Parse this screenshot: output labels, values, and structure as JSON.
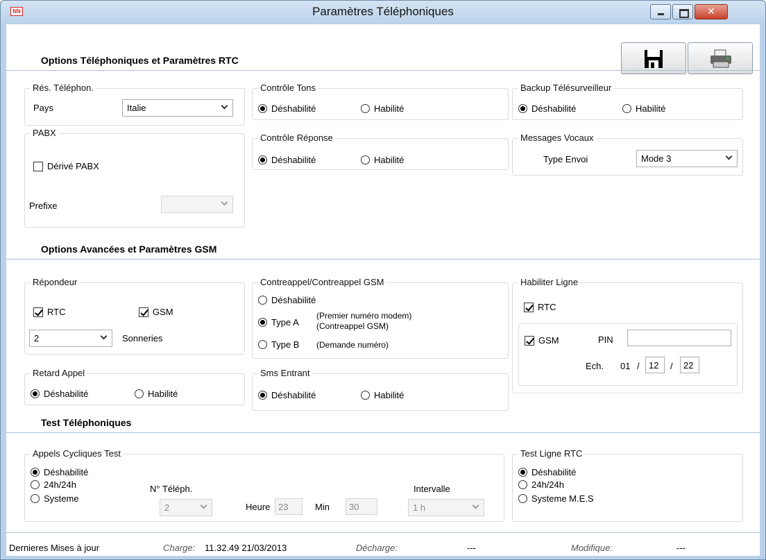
{
  "window": {
    "title": "Paramètres Téléphoniques",
    "app_icon_text": "NN"
  },
  "sections": {
    "rtc": "Options Téléphoniques et Paramètres RTC",
    "gsm": "Options Avancées et Paramètres GSM",
    "test": "Test Téléphoniques"
  },
  "res_telephon": {
    "title": "Rés. Téléphon.",
    "pays_label": "Pays",
    "pays_value": "Italie"
  },
  "controle_tons": {
    "title": "Contrôle Tons",
    "opt1": "Déshabilité",
    "opt2": "Habilité",
    "selected": "Déshabilité"
  },
  "backup": {
    "title": "Backup Télésurveilleur",
    "opt1": "Déshabilité",
    "opt2": "Habilité",
    "selected": "Déshabilité"
  },
  "pabx": {
    "title": "PABX",
    "derive_label": "Dérivé PABX",
    "derive_checked": false,
    "prefixe_label": "Prefixe",
    "prefixe_value": ""
  },
  "controle_reponse": {
    "title": "Contrôle Réponse",
    "opt1": "Déshabilité",
    "opt2": "Habilité",
    "selected": "Déshabilité"
  },
  "messages_vocaux": {
    "title": "Messages Vocaux",
    "type_label": "Type Envoi",
    "type_value": "Mode 3"
  },
  "repondeur": {
    "title": "Répondeur",
    "rtc_label": "RTC",
    "rtc_checked": true,
    "gsm_label": "GSM",
    "gsm_checked": true,
    "sonneries_value": "2",
    "sonneries_label": "Sonneries"
  },
  "contreappel": {
    "title": "Contreappel/Contreappel GSM",
    "opt1": "Déshabilité",
    "opt2": "Type A",
    "opt2_note1": "(Premier numéro modem)",
    "opt2_note2": "(Contreappel GSM)",
    "opt3": "Type B",
    "opt3_note": "(Demande numéro)",
    "selected": "Type A"
  },
  "habiliter_ligne": {
    "title": "Habiliter Ligne",
    "rtc_label": "RTC",
    "rtc_checked": true,
    "gsm_label": "GSM",
    "gsm_checked": true,
    "pin_label": "PIN",
    "pin_value": "",
    "ech_label": "Ech.",
    "ech_day": "01",
    "ech_sep1": "/",
    "ech_month": "12",
    "ech_sep2": "/",
    "ech_year": "22"
  },
  "retard_appel": {
    "title": "Retard Appel",
    "opt1": "Déshabilité",
    "opt2": "Habilité",
    "selected": "Déshabilité"
  },
  "sms_entrant": {
    "title": "Sms Entrant",
    "opt1": "Déshabilité",
    "opt2": "Habilité",
    "selected": "Déshabilité"
  },
  "appels_cycliques": {
    "title": "Appels Cycliques Test",
    "opt1": "Déshabilité",
    "opt2": "24h/24h",
    "opt3": "Systeme",
    "selected": "Déshabilité",
    "ntel_label": "N° Téléph.",
    "ntel_value": "2",
    "heure_label": "Heure",
    "heure_value": "23",
    "min_label": "Min",
    "min_value": "30",
    "intervalle_label": "Intervalle",
    "intervalle_value": "1 h"
  },
  "test_ligne": {
    "title": "Test Ligne RTC",
    "opt1": "Déshabilité",
    "opt2": "24h/24h",
    "opt3": "Systeme M.E.S",
    "selected": "Déshabilité"
  },
  "status": {
    "label": "Dernieres Mises à jour",
    "charge_label": "Charge:",
    "charge_value": "11.32.49 21/03/2013",
    "decharge_label": "Décharge:",
    "decharge_value": "---",
    "modifique_label": "Modifique:",
    "modifique_value": "---"
  },
  "icons": {
    "save": "floppy-disk-icon",
    "print": "printer-icon"
  }
}
